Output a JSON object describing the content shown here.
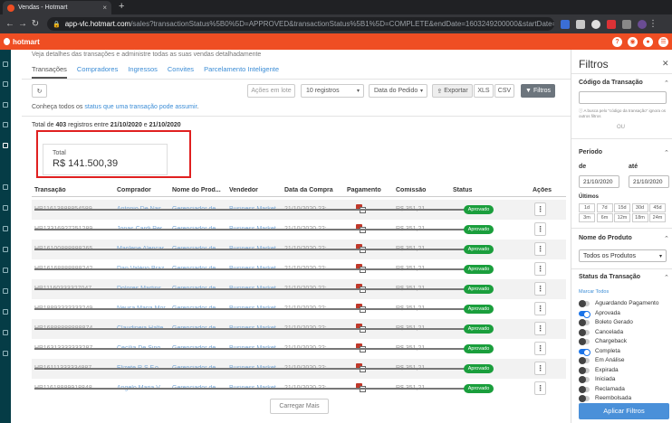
{
  "browser": {
    "tab_title": "Vendas - Hotmart",
    "url_host": "app-vlc.hotmart.com",
    "url_rest": "/sales?transactionStatus%5B0%5D=APPROVED&transactionStatus%5B1%5D=COMPLETE&endDate=1603249200000&startDate=1..."
  },
  "header": {
    "brand": "hotmart"
  },
  "page": {
    "subtitle": "Veja detalhes das transações e administre todas as suas vendas detalhadamente",
    "tabs": [
      "Transações",
      "Compradores",
      "Ingressos",
      "Convites",
      "Parcelamento Inteligente"
    ]
  },
  "toolbar": {
    "refresh_icon": "refresh-icon",
    "batch_label": "Ações em lote",
    "records_select": "10 registros",
    "date_select": "Data do Pedido",
    "export_label": "Exportar",
    "xls_label": "XLS",
    "csv_label": "CSV",
    "filters_label": "Filtros"
  },
  "helper": {
    "prefix": "Conheça todos os ",
    "link": "status que uma transação pode assumir",
    "suffix": "."
  },
  "summary": {
    "prefix": "Total de ",
    "count": "403",
    "middle": " registros entre ",
    "start": "21/10/2020",
    "and": " e ",
    "end": "21/10/2020",
    "total_label": "Total",
    "total_value": "R$ 141.500,39"
  },
  "table": {
    "headers": [
      "Transação",
      "Comprador",
      "Nome do Prod...",
      "Vendedor",
      "Data da Compra",
      "Pagamento",
      "Comissão",
      "Status",
      "Ações"
    ],
    "rows": [
      {
        "id": "HP11613888854589",
        "buyer": "Antonio De Nas...",
        "product": "Gerenciador de ...",
        "seller": "Business Market...",
        "date": "21/10/2020 23:...",
        "commission": "R$ 351,21",
        "status": "Aprovado"
      },
      {
        "id": "HP13316927251289",
        "buyer": "Jonas Cardi Per...",
        "product": "Gerenciador de ...",
        "seller": "Business Market...",
        "date": "21/10/2020 22:...",
        "commission": "R$ 351,21",
        "status": "Aprovado"
      },
      {
        "id": "HP16100888888265",
        "buyer": "Marilene Alencar...",
        "product": "Gerenciador de ...",
        "seller": "Business Market...",
        "date": "21/10/2020 22:...",
        "commission": "R$ 351,21",
        "status": "Aprovado"
      },
      {
        "id": "HP16168888888242",
        "buyer": "Dan Valério Braz...",
        "product": "Gerenciador de ...",
        "seller": "Business Market...",
        "date": "21/10/2020 22:...",
        "commission": "R$ 351,21",
        "status": "Aprovado"
      },
      {
        "id": "HP11160333327047",
        "buyer": "Dolores Martins...",
        "product": "Gerenciador de ...",
        "seller": "Business Market...",
        "date": "21/10/2020 22:...",
        "commission": "R$ 351,21",
        "status": "Aprovado"
      },
      {
        "id": "HP18893333333249",
        "buyer": "Neusa Maria Mor...",
        "product": "Gerenciador de ...",
        "seller": "Business Market...",
        "date": "21/10/2020 22:...",
        "commission": "R$ 351,21",
        "status": "Aprovado"
      },
      {
        "id": "HP16888888888874",
        "buyer": "Claudineia Halte...",
        "product": "Gerenciador de ...",
        "seller": "Business Market...",
        "date": "21/10/2020 22:...",
        "commission": "R$ 351,21",
        "status": "Aprovado"
      },
      {
        "id": "HP16313333333287",
        "buyer": "Cecília De Sino...",
        "product": "Gerenciador de ...",
        "seller": "Business Market...",
        "date": "21/10/2020 22:...",
        "commission": "R$ 351,21",
        "status": "Aprovado"
      },
      {
        "id": "HP16111333334887",
        "buyer": "Elizete R.S.F.o...",
        "product": "Gerenciador de ...",
        "seller": "Business Market...",
        "date": "21/10/2020 22:...",
        "commission": "R$ 351,21",
        "status": "Aprovado"
      },
      {
        "id": "HP11618889918848",
        "buyer": "Angelo Maria V...",
        "product": "Gerenciador de ...",
        "seller": "Business Market...",
        "date": "21/10/2020 22:...",
        "commission": "R$ 351,21",
        "status": "Aprovado"
      }
    ],
    "load_more": "Carregar Mais"
  },
  "filters": {
    "title": "Filtros",
    "code_section": "Código da Transação",
    "code_note": "A busca pelo \"código da transação\" ignora os outros filtros",
    "or": "OU",
    "period_section": "Período",
    "from_label": "de",
    "to_label": "até",
    "from_value": "21/10/2020",
    "to_value": "21/10/2020",
    "last_label": "Últimos",
    "chips": [
      "1d",
      "7d",
      "15d",
      "30d",
      "45d",
      "3m",
      "6m",
      "12m",
      "18m",
      "24m"
    ],
    "product_section": "Nome do Produto",
    "product_value": "Todos os Produtos",
    "status_section": "Status da Transação",
    "mark_all": "Marcar Todos",
    "statuses": [
      {
        "label": "Aguardando Pagamento",
        "on": false
      },
      {
        "label": "Aprovada",
        "on": true
      },
      {
        "label": "Boleto Gerado",
        "on": false
      },
      {
        "label": "Cancelada",
        "on": false
      },
      {
        "label": "Chargeback",
        "on": false
      },
      {
        "label": "Completa",
        "on": true
      },
      {
        "label": "Em Análise",
        "on": false
      },
      {
        "label": "Expirada",
        "on": false
      },
      {
        "label": "Iniciada",
        "on": false
      },
      {
        "label": "Reclamada",
        "on": false
      },
      {
        "label": "Reembolsada",
        "on": false
      }
    ],
    "apply_label": "Aplicar Filtros"
  },
  "colors": {
    "brand": "#ef4e23",
    "sidebar": "#053c46",
    "approved": "#1a9e3c",
    "link": "#3c8dd6",
    "highlight": "#e02020"
  }
}
